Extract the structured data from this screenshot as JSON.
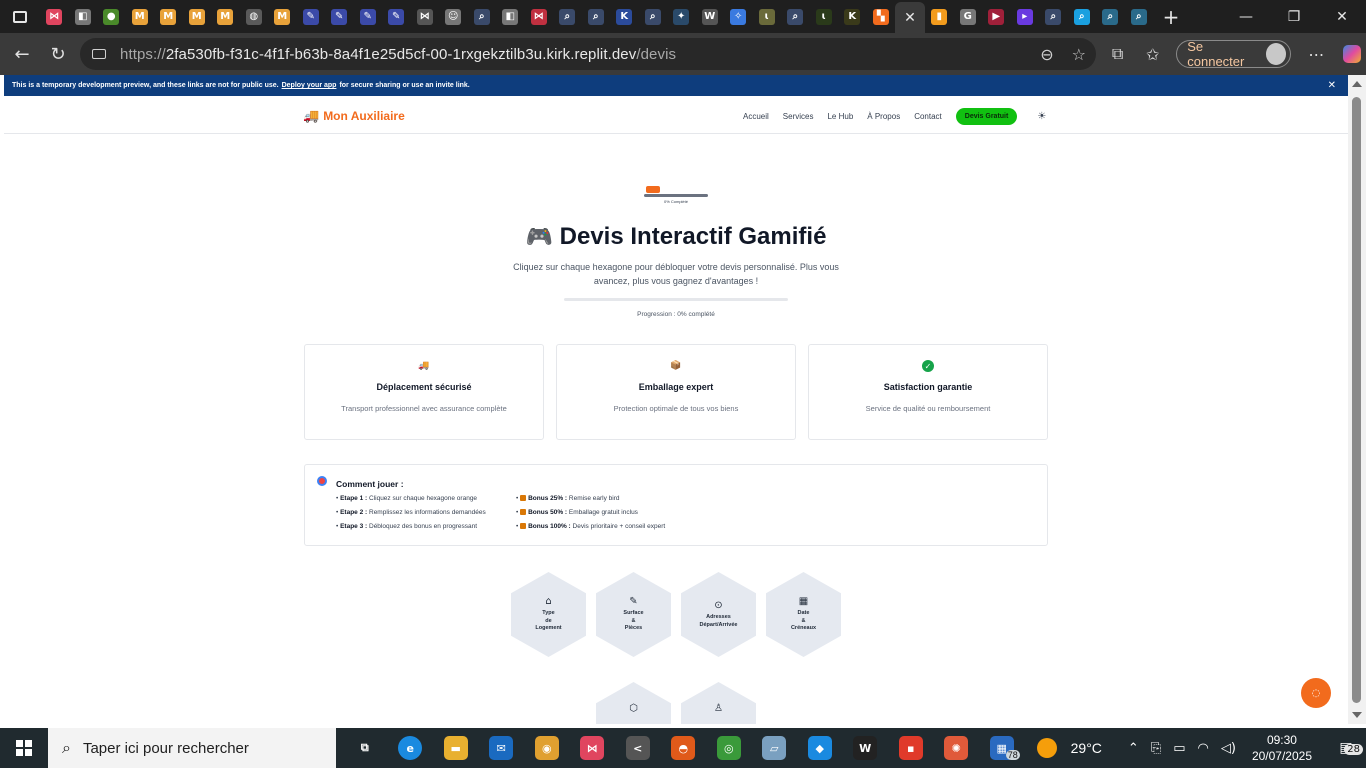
{
  "browser": {
    "tabs": [
      {
        "icon": "share-icon",
        "color": "#e0455f"
      },
      {
        "icon": "share-box-icon",
        "color": "#777777"
      },
      {
        "icon": "apple-icon",
        "color": "#4a8a2a"
      },
      {
        "icon": "gmail-icon",
        "color": "#e8a23a"
      },
      {
        "icon": "gmail-icon",
        "color": "#e8a23a"
      },
      {
        "icon": "gmail-icon",
        "color": "#e8a23a"
      },
      {
        "icon": "gmail-icon",
        "color": "#e8a23a"
      },
      {
        "icon": "globe-icon",
        "color": "#5a5a5a"
      },
      {
        "icon": "gmail-icon",
        "color": "#e8a23a"
      },
      {
        "icon": "edit-icon",
        "color": "#3b4aa8"
      },
      {
        "icon": "edit-icon",
        "color": "#3b4aa8"
      },
      {
        "icon": "edit-icon",
        "color": "#3b4aa8"
      },
      {
        "icon": "edit-icon",
        "color": "#3b4aa8"
      },
      {
        "icon": "share-icon",
        "color": "#555555"
      },
      {
        "icon": "face-icon",
        "color": "#777777"
      },
      {
        "icon": "search-icon",
        "color": "#3a4a6a"
      },
      {
        "icon": "share-box-icon",
        "color": "#777777"
      },
      {
        "icon": "share-icon",
        "color": "#c03040"
      },
      {
        "icon": "search-icon",
        "color": "#3a4a6a"
      },
      {
        "icon": "search-icon",
        "color": "#3a4a6a"
      },
      {
        "icon": "k-icon",
        "color": "#2b4b9b"
      },
      {
        "icon": "search-icon",
        "color": "#3a4a6a"
      },
      {
        "icon": "star-icon",
        "color": "#2a4a6a"
      },
      {
        "icon": "w-icon",
        "color": "#555555"
      },
      {
        "icon": "gemini-icon",
        "color": "#3a7ae0"
      },
      {
        "icon": "leaf-icon",
        "color": "#6a6a3a"
      },
      {
        "icon": "search-icon",
        "color": "#3a4a6a"
      },
      {
        "icon": "leaf-icon",
        "color": "#2a3a1a"
      },
      {
        "icon": "k-icon",
        "color": "#3a3a1a"
      },
      {
        "icon": "replit-icon",
        "color": "#f26b1d"
      },
      {
        "icon": "close-icon",
        "color": "#3a3a3a",
        "active": true
      },
      {
        "icon": "analytics-icon",
        "color": "#f29b1d"
      },
      {
        "icon": "google-icon",
        "color": "#777777"
      },
      {
        "icon": "youtube-icon",
        "color": "#a0203a"
      },
      {
        "icon": "video-icon",
        "color": "#6a3ae0"
      },
      {
        "icon": "search-icon",
        "color": "#3a4a6a"
      },
      {
        "icon": "search-icon",
        "color": "#1aa0e0"
      },
      {
        "icon": "search-icon",
        "color": "#2a6a8a"
      },
      {
        "icon": "search-icon",
        "color": "#2a6a8a"
      }
    ],
    "url_prefix": "https://",
    "url_host": "2fa530fb-f31c-4f1f-b63b-8a4f1e25d5cf-00-1rxgekztilb3u.kirk.replit.dev",
    "url_path": "/devis",
    "signin_label": "Se connecter"
  },
  "banner": {
    "text_before": "This is a temporary development preview, and these links are not for public use.",
    "link": "Deploy your app",
    "text_after": "for secure sharing or use an invite link."
  },
  "site": {
    "brand": "Mon Auxiliaire",
    "nav": [
      "Accueil",
      "Services",
      "Le Hub",
      "À Propos",
      "Contact"
    ],
    "cta": "Devis Gratuit"
  },
  "hero": {
    "mini_label": "0% Complété",
    "title": "Devis Interactif Gamifié",
    "subtitle": "Cliquez sur chaque hexagone pour débloquer votre devis personnalisé. Plus vous avancez, plus vous gagnez d'avantages !",
    "progress_percent": 0,
    "progress_label": "Progression : 0% complété"
  },
  "features": [
    {
      "icon": "truck-icon",
      "title": "Déplacement sécurisé",
      "desc": "Transport professionnel avec assurance complète"
    },
    {
      "icon": "box-icon",
      "title": "Emballage expert",
      "desc": "Protection optimale de tous vos biens"
    },
    {
      "icon": "check-icon",
      "title": "Satisfaction garantie",
      "desc": "Service de qualité ou remboursement"
    }
  ],
  "howto": {
    "title": "Comment jouer :",
    "steps": [
      {
        "label": "Etape 1 :",
        "text": "Cliquez sur chaque hexagone orange"
      },
      {
        "label": "Etape 2 :",
        "text": "Remplissez les informations demandées"
      },
      {
        "label": "Etape 3 :",
        "text": "Débloquez des bonus en progressant"
      }
    ],
    "bonuses": [
      {
        "label": "Bonus 25% :",
        "text": "Remise early bird"
      },
      {
        "label": "Bonus 50% :",
        "text": "Emballage gratuit inclus"
      },
      {
        "label": "Bonus 100% :",
        "text": "Devis prioritaire + conseil expert"
      }
    ]
  },
  "hexagons": [
    {
      "icon": "home-icon",
      "label": "Type\nde\nLogement"
    },
    {
      "icon": "ruler-icon",
      "label": "Surface\n&\nPièces"
    },
    {
      "icon": "map-pin-icon",
      "label": "Adresses\nDépart/Arrivée"
    },
    {
      "icon": "calendar-icon",
      "label": "Date\n&\nCréneaux"
    },
    {
      "icon": "box-icon",
      "label": ""
    },
    {
      "icon": "user-icon",
      "label": ""
    }
  ],
  "taskbar": {
    "search_placeholder": "Taper ici pour rechercher",
    "apps": [
      {
        "icon": "task-view-icon",
        "color": "transparent"
      },
      {
        "icon": "edge-icon",
        "color": "#1a8ae0"
      },
      {
        "icon": "file-explorer-icon",
        "color": "#e8b030"
      },
      {
        "icon": "mail-icon",
        "color": "#1a6ac0"
      },
      {
        "icon": "vpn-icon",
        "color": "#e0a030"
      },
      {
        "icon": "share-icon",
        "color": "#e0455f"
      },
      {
        "icon": "share-box-icon",
        "color": "#555555"
      },
      {
        "icon": "firefox-icon",
        "color": "#e05a1a"
      },
      {
        "icon": "chrome-icon",
        "color": "#3a9a3a"
      },
      {
        "icon": "notepad-icon",
        "color": "#7aa0c0"
      },
      {
        "icon": "docker-icon",
        "color": "#1a8ae0"
      },
      {
        "icon": "w-icon",
        "color": "#222222"
      },
      {
        "icon": "app-red-icon",
        "color": "#e03a2a"
      },
      {
        "icon": "sparkle-icon",
        "color": "#e05a3a"
      },
      {
        "icon": "calculator-icon",
        "color": "#2a6ac0"
      }
    ],
    "badge_count": "78",
    "temperature": "29°C",
    "time": "09:30",
    "date": "20/07/2025",
    "notification_count": "28"
  }
}
